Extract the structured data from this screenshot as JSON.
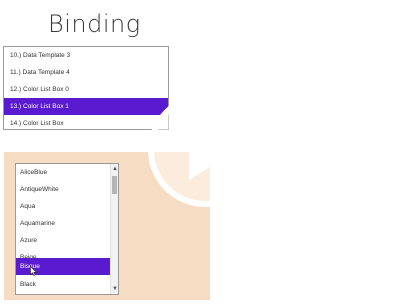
{
  "page": {
    "title": "Binding"
  },
  "nav": {
    "items": [
      {
        "label": "10.) Data Template 3"
      },
      {
        "label": "11.) Data Template 4"
      },
      {
        "label": "12.) Color List Box 0"
      },
      {
        "label": "13.) Color List Box 1",
        "selected": true
      },
      {
        "label": "14.) Color List Box"
      }
    ]
  },
  "colors": {
    "items": [
      {
        "label": "AliceBlue"
      },
      {
        "label": "AntiqueWhite"
      },
      {
        "label": "Aqua"
      },
      {
        "label": "Aquamarine"
      },
      {
        "label": "Azure"
      },
      {
        "label": "Beige"
      },
      {
        "label": "Bisque",
        "selected": true
      },
      {
        "label": "Black"
      }
    ],
    "scroll_up_glyph": "▲",
    "scroll_down_glyph": "▼"
  },
  "icons": {
    "play": "play-icon",
    "cursor": "mouse-pointer-icon"
  },
  "theme": {
    "accent": "#5a1bd0",
    "pane_background": "#f7dcc4"
  }
}
